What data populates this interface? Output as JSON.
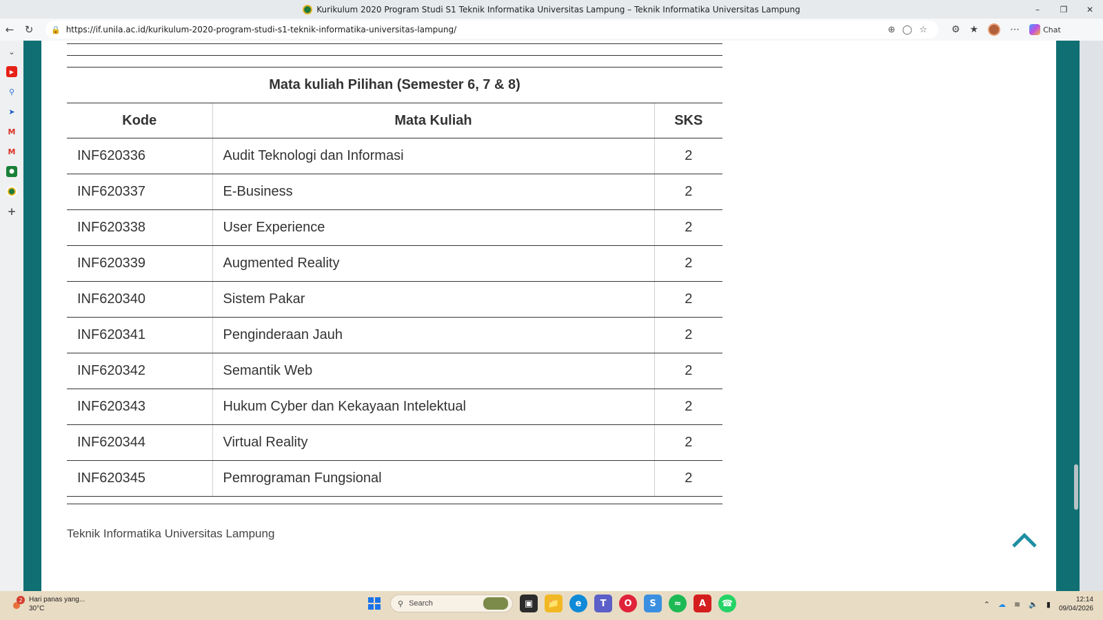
{
  "browser": {
    "window_title": "Kurikulum 2020 Program Studi S1 Teknik Informatika Universitas Lampung – Teknik Informatika Universitas Lampung",
    "url": "https://if.unila.ac.id/kurikulum-2020-program-studi-s1-teknik-informatika-universitas-lampung/",
    "chat_label": "Chat"
  },
  "table": {
    "caption": "Mata kuliah Pilihan (Semester 6, 7 & 8)",
    "headers": [
      "Kode",
      "Mata Kuliah",
      "SKS"
    ],
    "rows": [
      {
        "kode": "INF620336",
        "nama": "Audit Teknologi dan Informasi",
        "sks": "2"
      },
      {
        "kode": "INF620337",
        "nama": "E-Business",
        "sks": "2"
      },
      {
        "kode": "INF620338",
        "nama": "User Experience",
        "sks": "2"
      },
      {
        "kode": "INF620339",
        "nama": "Augmented Reality",
        "sks": "2"
      },
      {
        "kode": "INF620340",
        "nama": "Sistem Pakar",
        "sks": "2"
      },
      {
        "kode": "INF620341",
        "nama": "Penginderaan Jauh",
        "sks": "2"
      },
      {
        "kode": "INF620342",
        "nama": "Semantik Web",
        "sks": "2"
      },
      {
        "kode": "INF620343",
        "nama": "Hukum Cyber dan Kekayaan Intelektual",
        "sks": "2"
      },
      {
        "kode": "INF620344",
        "nama": "Virtual Reality",
        "sks": "2"
      },
      {
        "kode": "INF620345",
        "nama": "Pemrograman Fungsional",
        "sks": "2"
      }
    ]
  },
  "footer": {
    "text": "Teknik Informatika Universitas Lampung"
  },
  "taskbar": {
    "weather_badge": "2",
    "weather_line1": "Hari panas yang...",
    "weather_line2": "30°C",
    "search_placeholder": "Search",
    "time": "12:14",
    "date": "09/04/2026"
  },
  "colors": {
    "frame": "#0f6f72",
    "taskbar": "#e9dcc4"
  }
}
